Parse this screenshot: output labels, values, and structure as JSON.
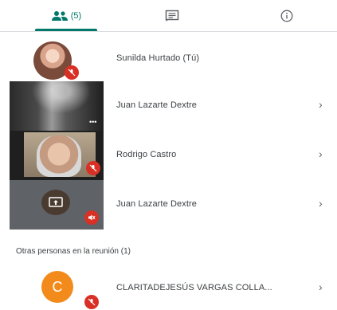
{
  "tabs": {
    "people_count": "(5)",
    "people_icon": "people-icon",
    "chat_icon": "chat-icon",
    "info_icon": "info-icon",
    "accent": "#00796b"
  },
  "participants": [
    {
      "name": "Sunilda Hurtado (Tú)"
    },
    {
      "name": "Juan Lazarte Dextre"
    },
    {
      "name": "Rodrigo Castro"
    },
    {
      "name": "Juan Lazarte Dextre"
    }
  ],
  "others": {
    "title": "Otras personas en la reunión (1)",
    "items": [
      {
        "avatar_letter": "C",
        "name": "CLARITADEJESÚS VARGAS COLLA..."
      }
    ]
  },
  "colors": {
    "muted_red": "#d93025",
    "avatar_orange": "#f28b1b"
  }
}
